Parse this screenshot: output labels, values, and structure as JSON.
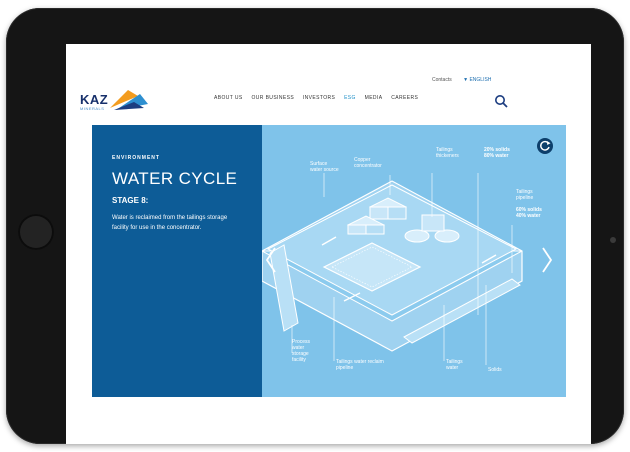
{
  "header": {
    "logo_text": "KAZ",
    "logo_sub": "MINERALS",
    "top_links": {
      "contacts": "Contacts",
      "language": "▼ ENGLISH"
    },
    "nav": [
      "ABOUT US",
      "OUR BUSINESS",
      "INVESTORS",
      "ESG",
      "MEDIA",
      "CAREERS"
    ],
    "nav_active_index": 3
  },
  "hero": {
    "eyebrow": "ENVIRONMENT",
    "title": "WATER CYCLE",
    "stage": "STAGE 8:",
    "description": "Water is reclaimed from the tailings storage facility for use in the concentrator."
  },
  "diagram_labels": {
    "surface_water": "Surface water source",
    "copper_concentrator": "Copper concentrator",
    "tailings_thickeners": "Tailings thickeners",
    "solids_water_top": "20% solids 80% water",
    "tailings_pipeline": "Tailings pipeline",
    "solids_water_pipeline": "60% solids 40% water",
    "process_water": "Process water storage facility",
    "reclaim_pipeline": "Tailings water reclaim pipeline",
    "tailings_water": "Tailings water",
    "solids": "Solids"
  },
  "colors": {
    "panel_blue": "#0d5c97",
    "diagram_blue": "#7fc3ea",
    "accent": "#1e8fc7",
    "logo_navy": "#17306b"
  },
  "icons": [
    "search-icon",
    "reload-icon",
    "chevron-left-icon",
    "chevron-right-icon",
    "home-button"
  ]
}
